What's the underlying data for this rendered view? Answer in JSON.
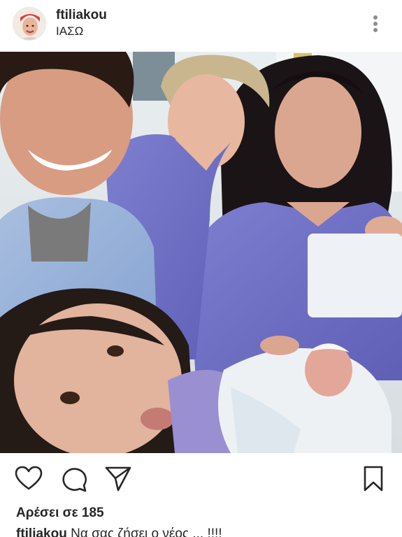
{
  "post": {
    "username": "ftiliakou",
    "location": "ΙΑΣΩ"
  },
  "icons": {
    "more": "more-vertical-icon",
    "like": "heart-icon",
    "comment": "comment-icon",
    "share": "send-icon",
    "save": "bookmark-icon"
  },
  "likes": {
    "label": "Αρέσει σε 185"
  },
  "caption": {
    "user": "ftiliakou",
    "text": "Να σας ζήσει ο νέος ... !!!!"
  },
  "colors": {
    "text": "#262626",
    "scrubs": "#6f6fc4",
    "background": "#ffffff"
  }
}
